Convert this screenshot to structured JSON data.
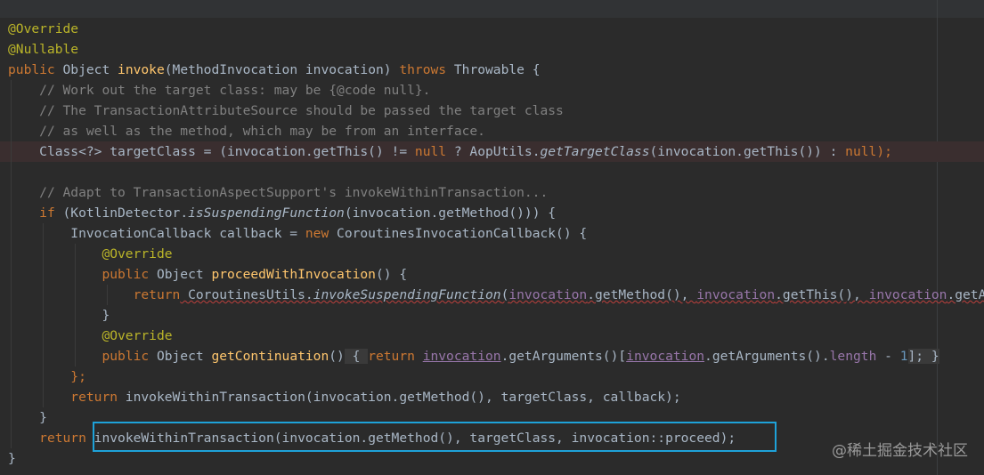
{
  "lines": [
    {
      "kind": "ann",
      "text": "@Override"
    },
    {
      "kind": "ann",
      "text": "@Nullable"
    },
    {
      "t1": "public",
      "t2": "Object",
      "t3": "invoke",
      "t4": "(MethodInvocation invocation)",
      "t5": "throws",
      "t6": "Throwable {"
    },
    {
      "text": "// Work out the target class: may be {@code null}."
    },
    {
      "text": "// The TransactionAttributeSource should be passed the target class"
    },
    {
      "text": "// as well as the method, which may be from an interface."
    },
    {
      "p1": "Class<?> targetClass = (invocation.getThis() != ",
      "p2": "null",
      "p3": " ? AopUtils.",
      "p4": "getTargetClass",
      "p5": "(invocation.getThis()) : ",
      "p6": "null",
      "p7": ");"
    },
    {
      "text": ""
    },
    {
      "text": "// Adapt to TransactionAspectSupport's invokeWithinTransaction..."
    },
    {
      "p1": "if",
      "p2": " (KotlinDetector.",
      "p3": "isSuspendingFunction",
      "p4": "(invocation.getMethod())) {"
    },
    {
      "p1": "InvocationCallback callback = ",
      "p2": "new",
      "p3": " CoroutinesInvocationCallback() {"
    },
    {
      "text": "@Override"
    },
    {
      "p1": "public",
      "p2": " Object ",
      "p3": "proceedWithInvocation",
      "p4": "() {"
    },
    {
      "p1": "return",
      "p2": " CoroutinesUtils.",
      "p3": "invokeSuspendingFunction",
      "p4": "(",
      "p5": "invocation",
      "p6": ".getMethod(), ",
      "p7": "invocation",
      "p8": ".getThis(), ",
      "p9": "invocation",
      "p10": ".getArgu"
    },
    {
      "text": "}"
    },
    {
      "text": "@Override"
    },
    {
      "p1": "public",
      "p2": " Object ",
      "p3": "getContinuation",
      "p4": "()",
      "p5": " { ",
      "p6": "return",
      "p7": "invocation",
      "p8": ".getArguments()[",
      "p9": "invocation",
      "p10": ".getArguments().",
      "p11": "length",
      "p12": " - ",
      "p13": "1",
      "p14": "]; }"
    },
    {
      "text": "};"
    },
    {
      "p1": "return",
      "p2": " invokeWithinTransaction(invocation.getMethod(), targetClass, callback);"
    },
    {
      "text": "}"
    },
    {
      "p1": "return",
      "p2": "invokeWithinTransaction(invocation.getMethod(), targetClass, invocation::proceed);"
    },
    {
      "text": "}"
    }
  ],
  "watermark": "@稀土掘金技术社区"
}
